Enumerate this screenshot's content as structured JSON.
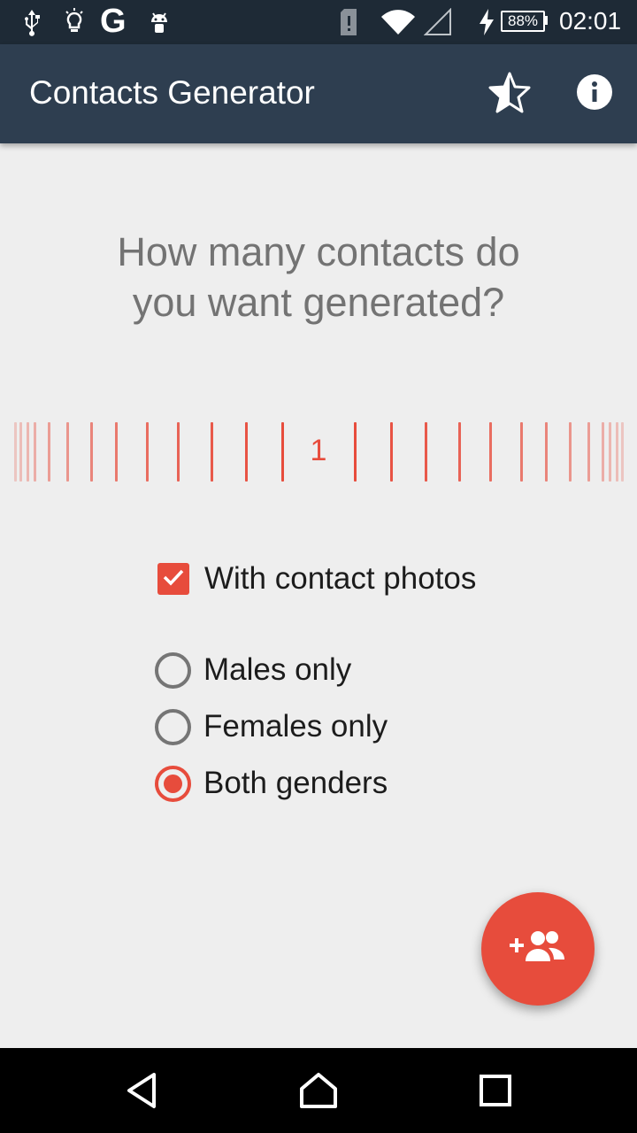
{
  "status_bar": {
    "icons": [
      "usb-icon",
      "lightbulb-icon",
      "google-icon",
      "android-icon",
      "sim-alert-icon",
      "wifi-icon",
      "signal-icon",
      "charging-icon"
    ],
    "google_letter": "G",
    "battery": "88%",
    "time": "02:01"
  },
  "app_bar": {
    "title": "Contacts Generator",
    "actions": [
      "star-half-icon",
      "info-icon"
    ]
  },
  "main": {
    "question_line1": "How many contacts do",
    "question_line2": "you want generated?",
    "picker_value": "1",
    "with_photos": {
      "label": "With contact photos",
      "checked": true
    },
    "gender_options": [
      {
        "label": "Males only",
        "selected": false
      },
      {
        "label": "Females only",
        "selected": false
      },
      {
        "label": "Both genders",
        "selected": true
      }
    ]
  },
  "fab": {
    "icon": "add-people-icon"
  },
  "nav_bar": {
    "buttons": [
      "back-icon",
      "home-icon",
      "recents-icon"
    ]
  },
  "colors": {
    "accent": "#e74c3c",
    "app_bar": "#2e3e50",
    "status_bar": "#1e2a36",
    "background": "#eeeeee"
  }
}
